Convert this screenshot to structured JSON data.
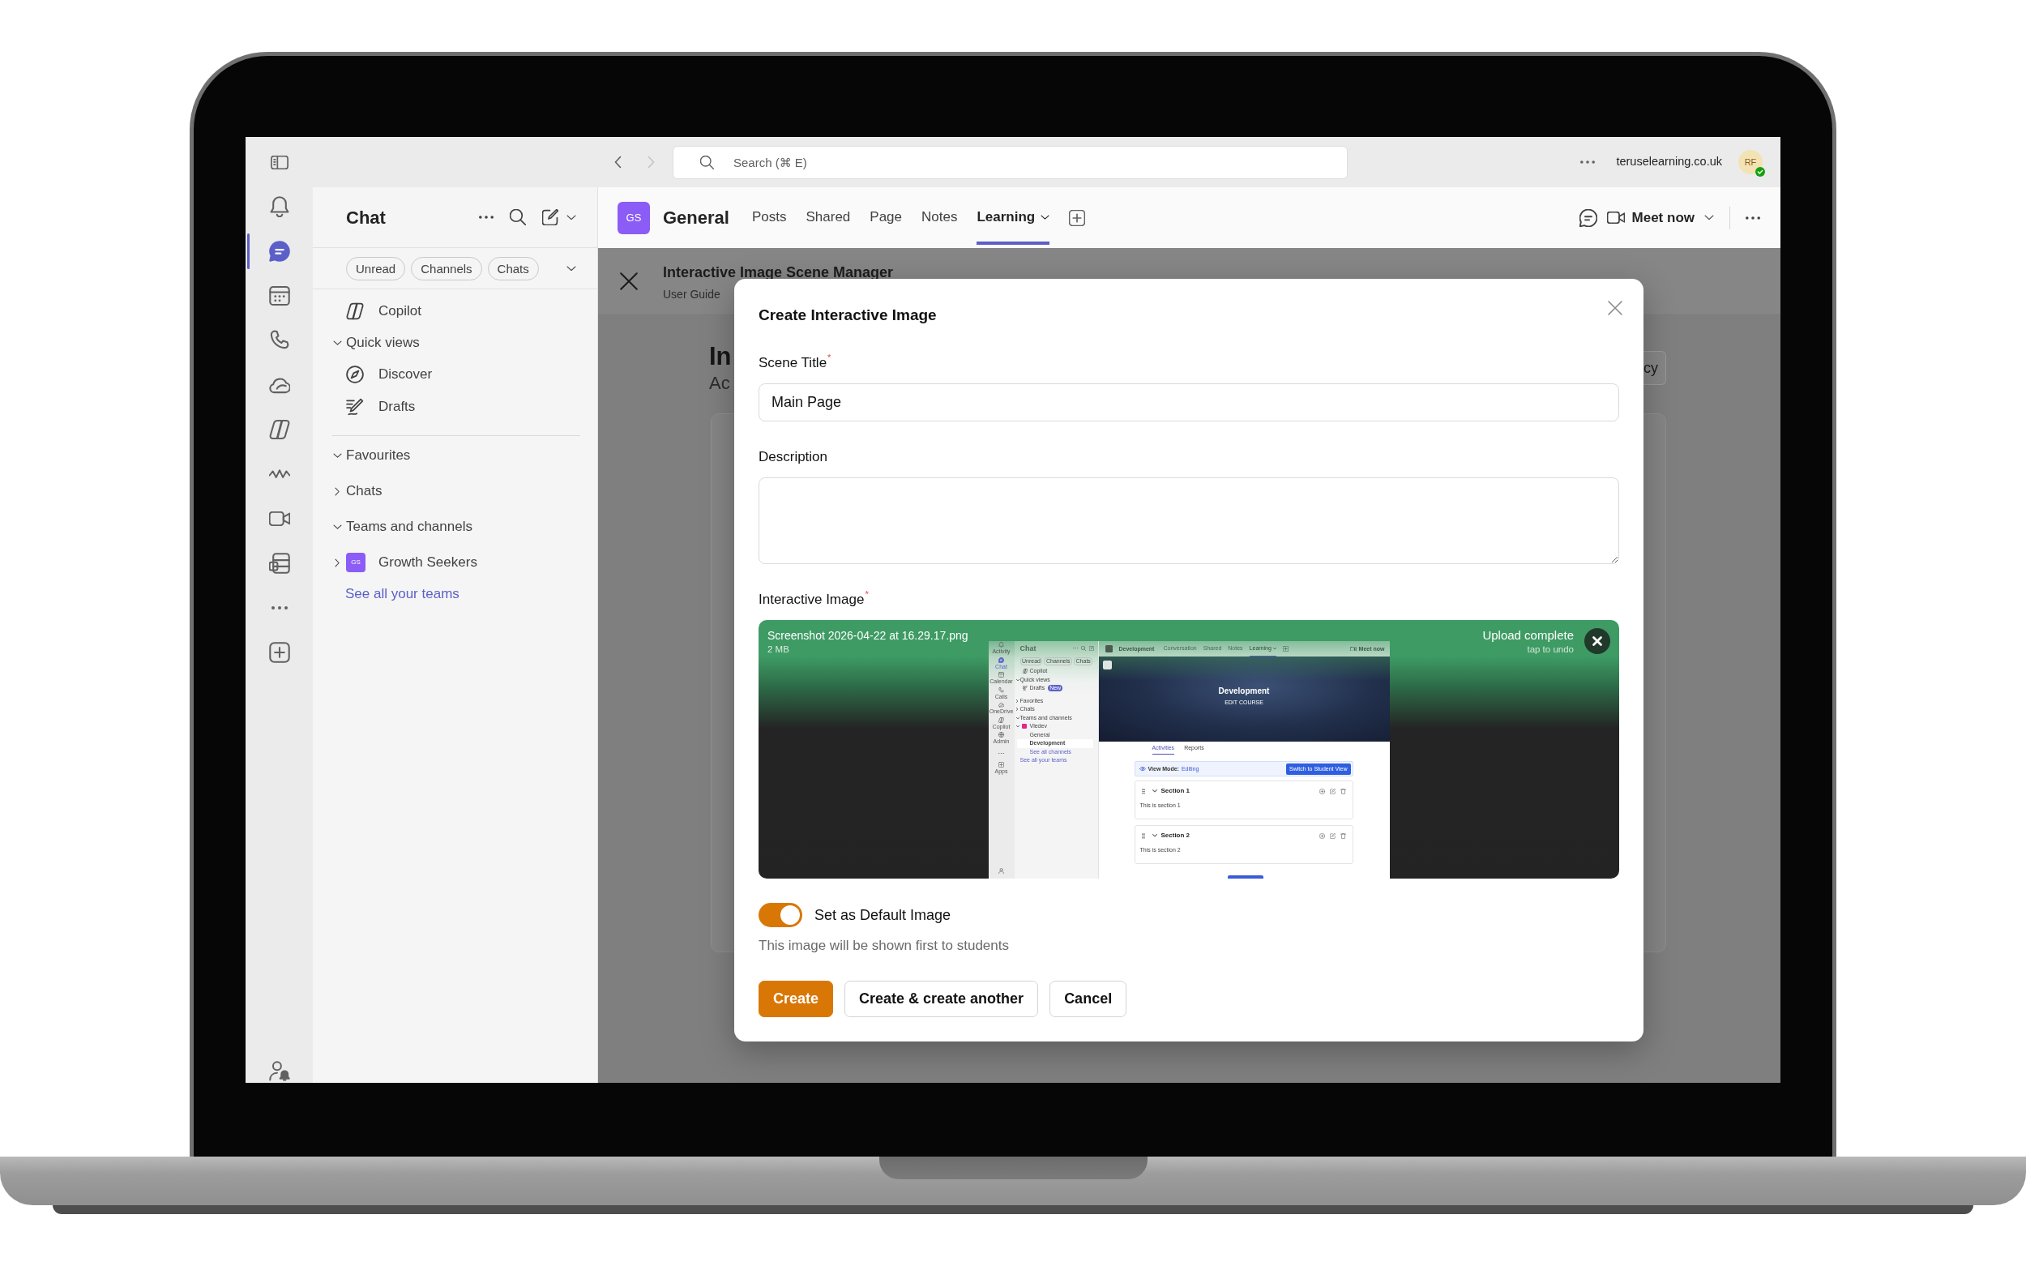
{
  "title_bar": {
    "history": [
      {
        "disabled": false
      },
      {
        "disabled": true
      }
    ],
    "search": {
      "placeholder": "Search (⌘ E)"
    },
    "account": "teruselearning.co.uk",
    "avatar": {
      "initials": "RF",
      "online": true
    }
  },
  "app_rail": [
    {
      "selected": false
    },
    {
      "selected": true
    },
    {
      "selected": false
    },
    {
      "selected": false
    },
    {
      "selected": false
    },
    {
      "selected": false
    },
    {
      "selected": false
    },
    {
      "selected": false
    },
    {
      "selected": false
    },
    {
      "selected": false
    },
    {
      "selected": false
    }
  ],
  "chat_pane": {
    "title": "Chat",
    "filters": [
      {
        "label": "Unread",
        "selected": false
      },
      {
        "label": "Channels",
        "selected": false
      },
      {
        "label": "Chats",
        "selected": false
      }
    ],
    "pinned": [
      {
        "kind": "item",
        "label": "Copilot"
      },
      {
        "kind": "group",
        "label": "Quick views",
        "expanded": true,
        "children": [
          {
            "kind": "item",
            "label": "Discover"
          },
          {
            "kind": "item",
            "label": "Drafts"
          }
        ]
      }
    ],
    "sections": [
      {
        "kind": "group",
        "label": "Favourites",
        "expanded": true
      },
      {
        "kind": "group",
        "label": "Chats",
        "expanded": false
      },
      {
        "kind": "group",
        "label": "Teams and channels",
        "expanded": true,
        "children": [
          {
            "kind": "team",
            "label": "Growth Seekers",
            "initials": "GS",
            "expanded": false
          },
          {
            "kind": "link",
            "label": "See all your teams"
          }
        ]
      }
    ]
  },
  "channel_header": {
    "team_initials": "GS",
    "channel": "General",
    "tabs": [
      {
        "label": "Posts",
        "selected": false,
        "dropdown": false
      },
      {
        "label": "Shared",
        "selected": false,
        "dropdown": false
      },
      {
        "label": "Page",
        "selected": false,
        "dropdown": false
      },
      {
        "label": "Notes",
        "selected": false,
        "dropdown": false
      },
      {
        "label": "Learning",
        "selected": true,
        "dropdown": true
      }
    ],
    "meet_button": "Meet now"
  },
  "background_page": {
    "title": "Interactive Image Scene Manager",
    "subtitle": "User Guide",
    "heading": "In",
    "subheading": "Ac",
    "button": "cy"
  },
  "modal": {
    "title": "Create Interactive Image",
    "fields": [
      {
        "kind": "text",
        "label": "Scene Title$^{*}$",
        "value": "Main Page"
      },
      {
        "kind": "textarea",
        "label": "Description"
      },
      {
        "kind": "upload",
        "label": "Interactive Image$^{*}$",
        "file_name": "Screenshot 2026-04-22 at 16.29.17.png",
        "file_size": "2 MB",
        "status": "Upload complete",
        "undo_hint": "tap to undo",
        "preview": {
          "rail": [
            {
              "label": "Activity",
              "selected": false
            },
            {
              "label": "Chat",
              "selected": true
            },
            {
              "label": "Calendar",
              "selected": false
            },
            {
              "label": "Calls",
              "selected": false
            },
            {
              "label": "OneDrive",
              "selected": false
            },
            {
              "label": "Copilot",
              "selected": false
            },
            {
              "label": "Admin",
              "selected": false
            },
            {
              "selected": false
            },
            {
              "label": "Apps",
              "selected": false
            }
          ],
          "header": {
            "title": "Development",
            "tabs": [
              {
                "label": "Conversation",
                "selected": false,
                "dropdown": false
              },
              {
                "label": "Shared",
                "selected": false,
                "dropdown": false
              },
              {
                "label": "Notes",
                "selected": false,
                "dropdown": false
              },
              {
                "label": "Learning",
                "selected": true,
                "dropdown": true
              }
            ],
            "meet_button": "Meet now"
          },
          "sidebar_title": "Chat",
          "filters": [
            "Unread",
            "Channels",
            "Chats"
          ],
          "sidebar_pinned": [
            {
              "kind": "item",
              "label": "Copilot"
            },
            {
              "kind": "group",
              "label": "Quick views",
              "expanded": true,
              "children": [
                {
                  "kind": "item",
                  "label": "Drafts",
                  "badge": "New"
                }
              ]
            }
          ],
          "sidebar_sections": [
            {
              "kind": "group",
              "label": "Favorites",
              "expanded": false
            },
            {
              "kind": "group",
              "label": "Chats",
              "expanded": false
            },
            {
              "kind": "group",
              "label": "Teams and channels",
              "expanded": true,
              "children": [
                {
                  "kind": "team",
                  "label": "Vledev",
                  "expanded": true,
                  "children": [
                    {
                      "kind": "channel",
                      "label": "General",
                      "selected": false
                    },
                    {
                      "kind": "channel",
                      "label": "Development",
                      "selected": true
                    },
                    {
                      "kind": "link",
                      "label": "See all channels"
                    }
                  ]
                },
                {
                  "kind": "link",
                  "label": "See all your teams"
                }
              ]
            }
          ],
          "banner": {
            "title": "Development",
            "subtitle": "EDIT COURSE"
          },
          "tabs": [
            {
              "label": "Activities",
              "selected": true
            },
            {
              "label": "Reports",
              "selected": false
            }
          ],
          "view_mode": {
            "label": "View Mode:",
            "value": "Editing",
            "button": "Switch to Student View"
          },
          "sections": [
            {
              "title": "Section 1",
              "body": "This is section 1",
              "expanded": true
            },
            {
              "title": "Section 2",
              "body": "This is section 2",
              "expanded": true
            }
          ]
        }
      }
    ],
    "toggle": {
      "label": "Set as Default Image",
      "on": true
    },
    "help": "This image will be shown first to students",
    "buttons": [
      {
        "label": "Create",
        "kind": "primary"
      },
      {
        "label": "Create & create another",
        "kind": "secondary"
      },
      {
        "label": "Cancel",
        "kind": "secondary"
      }
    ]
  }
}
